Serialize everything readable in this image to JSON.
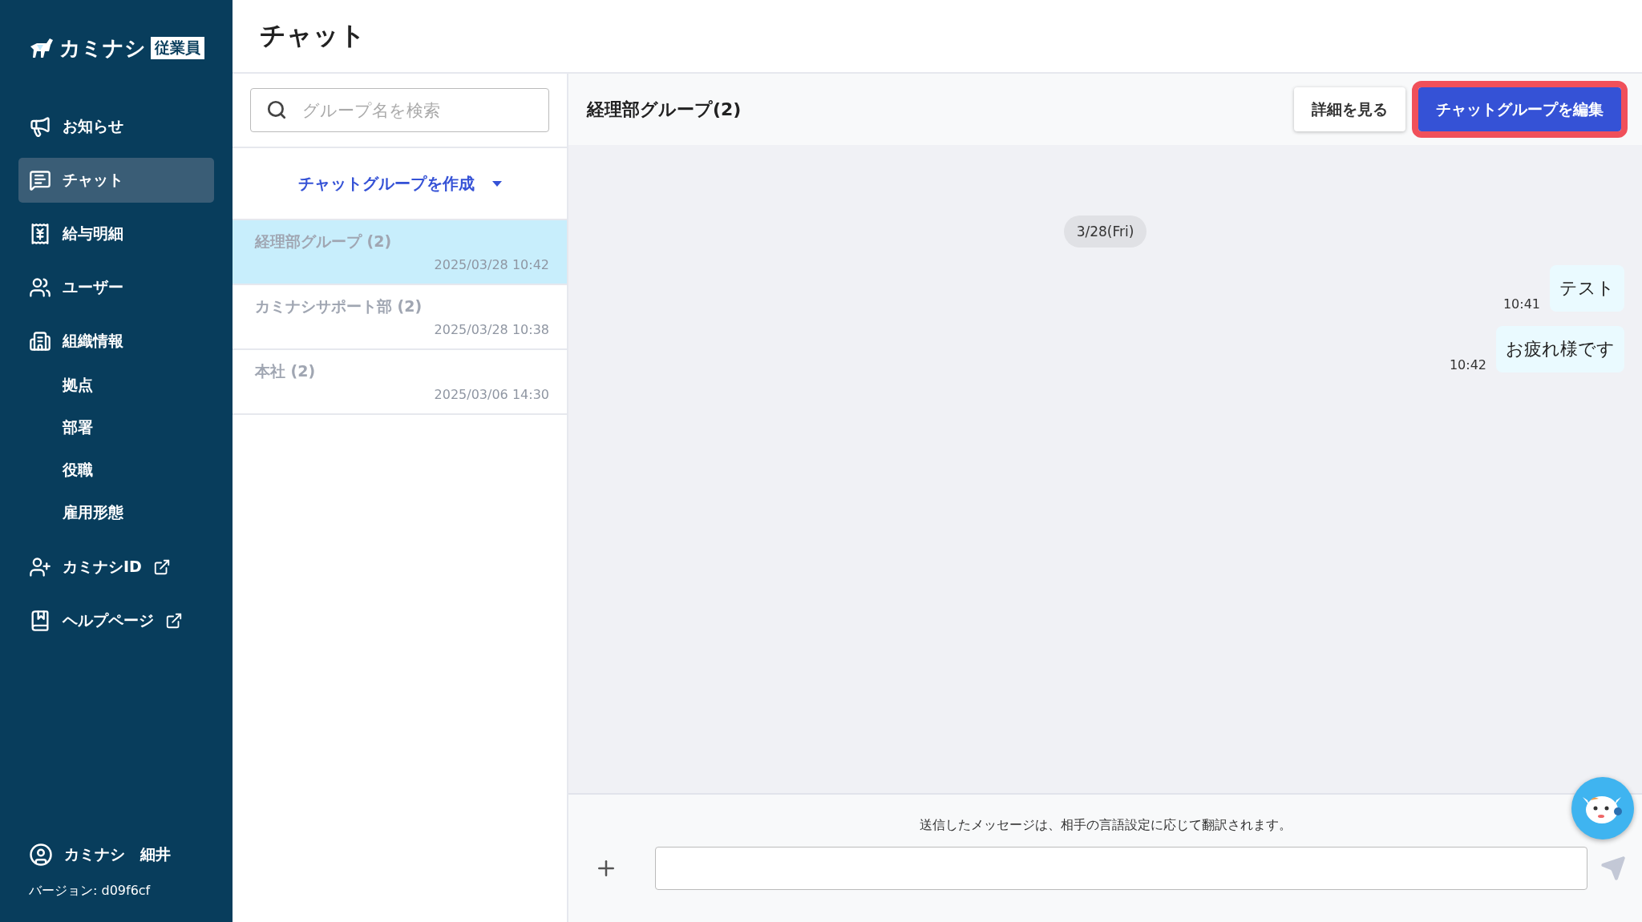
{
  "sidebar": {
    "logo": {
      "text": "カミナシ",
      "badge": "従業員"
    },
    "nav": [
      {
        "kind": "megaphone",
        "label": "お知らせ",
        "selected": false,
        "external": false
      },
      {
        "kind": "chat",
        "label": "チャット",
        "selected": true,
        "external": false
      },
      {
        "kind": "payslip",
        "label": "給与明細",
        "selected": false,
        "external": false
      },
      {
        "kind": "users",
        "label": "ユーザー",
        "selected": false,
        "external": false
      },
      {
        "kind": "building",
        "label": "組織情報",
        "selected": false,
        "external": false,
        "children": [
          {
            "label": "拠点"
          },
          {
            "label": "部署"
          },
          {
            "label": "役職"
          },
          {
            "label": "雇用形態"
          }
        ]
      },
      {
        "kind": "user-plus",
        "label": "カミナシID",
        "selected": false,
        "external": true
      },
      {
        "kind": "book",
        "label": "ヘルプページ",
        "selected": false,
        "external": true
      }
    ],
    "user": "カミナシ　細井",
    "version": "バージョン: d09f6cf"
  },
  "page_title": "チャット",
  "group_list": {
    "search": {
      "placeholder": "グループ名を検索"
    },
    "create_button": "チャットグループを作成",
    "groups": [
      {
        "name": "経理部グループ (2)",
        "time": "2025/03/28 10:42",
        "selected": true
      },
      {
        "name": "カミナシサポート部 (2)",
        "time": "2025/03/28 10:38",
        "selected": false
      },
      {
        "name": "本社 (2)",
        "time": "2025/03/06 14:30",
        "selected": false
      }
    ]
  },
  "chat": {
    "title": "経理部グループ(2)",
    "buttons": [
      {
        "label": "詳細を見る",
        "kind": "secondary",
        "highlighted": false
      },
      {
        "label": "チャットグループを編集",
        "kind": "primary",
        "highlighted": true
      }
    ],
    "date": "3/28(Fri)",
    "messages": [
      {
        "text": "テスト",
        "time": "10:41"
      },
      {
        "text": "お疲れ様です",
        "time": "10:42"
      }
    ],
    "notice": "送信したメッセージは、相手の言語設定に応じて翻訳されます。"
  }
}
